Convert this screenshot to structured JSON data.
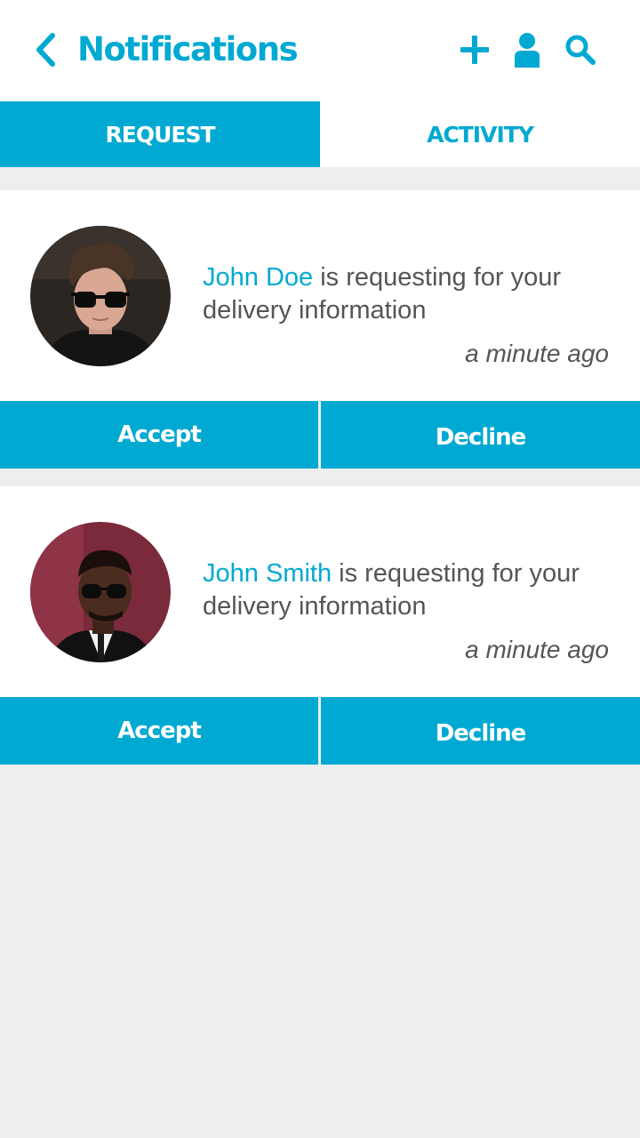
{
  "header": {
    "title": "Notifications",
    "icons": [
      "back-chevron-icon",
      "plus-icon",
      "user-icon",
      "search-icon"
    ]
  },
  "tabs": [
    {
      "label": "REQUEST",
      "active": true
    },
    {
      "label": "ACTIVITY",
      "active": false
    }
  ],
  "notifications": [
    {
      "name": "John Doe",
      "message": " is requesting for your delivery information",
      "time": "a minute ago",
      "accept_label": "Accept",
      "decline_label": "Decline"
    },
    {
      "name": "John Smith",
      "message": " is requesting for your delivery information",
      "time": "a minute ago",
      "accept_label": "Accept",
      "decline_label": "Decline"
    }
  ],
  "colors": {
    "accent": "#00a9d2",
    "background": "#eeeeee",
    "text": "#555555"
  }
}
